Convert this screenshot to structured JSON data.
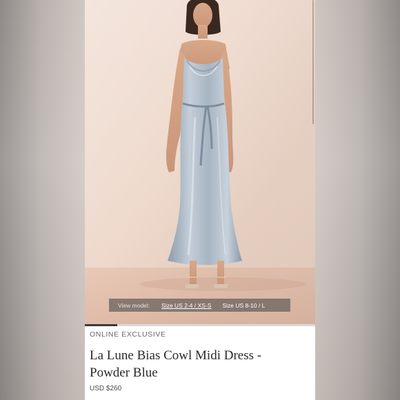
{
  "product": {
    "category": "ONLINE EXCLUSIVE",
    "title": "La Lune Bias Cowl Midi Dress - Powder Blue",
    "price": "USD $260"
  },
  "view_model": {
    "label": "View model:",
    "sizes": [
      "Size US 2-4 / XS-S",
      "Size US 8-10 / L"
    ]
  },
  "gallery": {
    "progress": 0.14
  },
  "colors": {
    "dress": "#a9b6c3",
    "backdrop": "#efdbce",
    "overlay": "#6e6462"
  }
}
